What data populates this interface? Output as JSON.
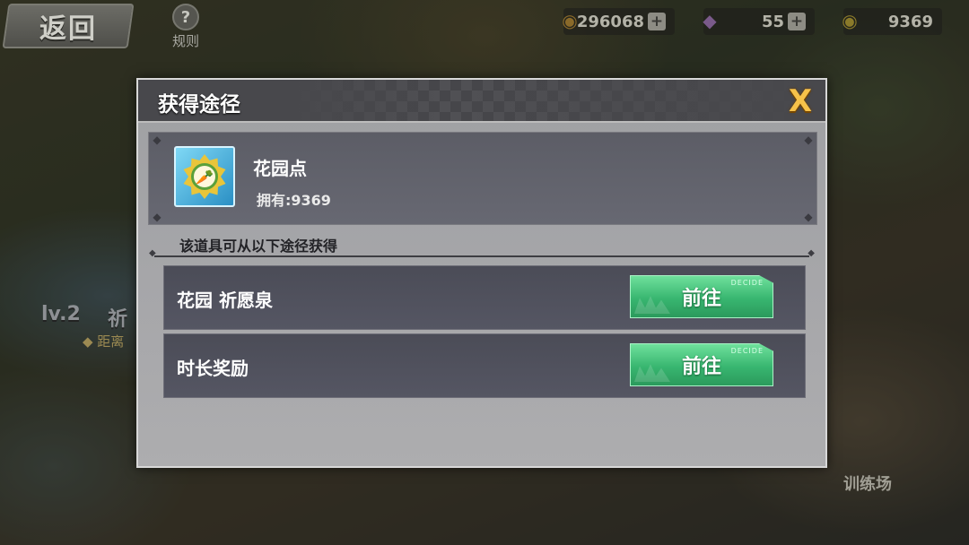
{
  "hud": {
    "back_label": "返回",
    "rules_label": "规则",
    "rules_icon_glyph": "?",
    "resources": [
      {
        "icon": "coin-icon",
        "icon_glyph": "◉",
        "value": "296068",
        "plus": "+"
      },
      {
        "icon": "gem-icon",
        "icon_glyph": "◆",
        "value": "55",
        "plus": "+"
      },
      {
        "icon": "gold-icon",
        "icon_glyph": "◉",
        "value": "9369"
      }
    ]
  },
  "map": {
    "level": "lv.2",
    "level_name": "祈",
    "distance_text": "◆ 距离",
    "training_label": "训练场"
  },
  "dialog": {
    "title": "获得途径",
    "close_glyph": "X",
    "item": {
      "name": "花园点",
      "owned_text": "拥有:9369",
      "icon": "carrot-badge-icon",
      "icon_glyph": "🥕"
    },
    "source_heading": "该道具可从以下途径获得",
    "routes": [
      {
        "label": "花园 祈愿泉",
        "button_label": "前往",
        "button_tag": "DECIDE"
      },
      {
        "label": "时长奖励",
        "button_label": "前往",
        "button_tag": "DECIDE"
      }
    ]
  },
  "colors": {
    "accent_green": "#38b670",
    "close_gold": "#f7c24a",
    "dialog_bg": "#a7a7aa",
    "card_bg": "#5c5d66"
  }
}
